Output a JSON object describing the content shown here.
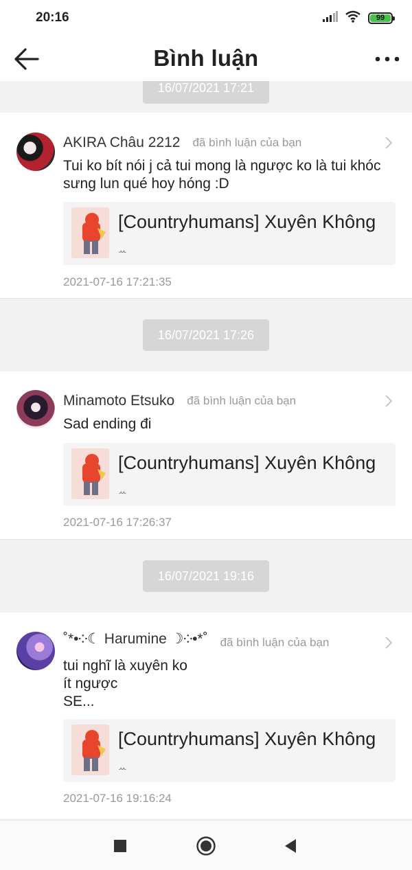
{
  "status_bar": {
    "time": "20:16",
    "battery": "99",
    "icons": [
      "signal-icon",
      "wifi-icon",
      "battery-icon"
    ]
  },
  "header": {
    "title": "Bình luận",
    "back_icon": "arrow-left-icon",
    "more_icon": "more-dots-icon"
  },
  "comments": [
    {
      "date_label": "16/07/2021 17:21",
      "author": "AKIRA Châu 2212",
      "action": "đã bình luận của bạn",
      "lines": [
        "Tui ko bít nói j cả tui mong là ngược ko là tui khóc",
        "sưng lun qué hoy hóng :D"
      ],
      "story_title": "[Countryhumans] Xuyên Không",
      "story_sub": "ꕀ",
      "timestamp": "2021-07-16 17:21:35"
    },
    {
      "date_label": "16/07/2021 17:26",
      "author": "Minamoto Etsuko",
      "action": "đã bình luận của bạn",
      "lines": [
        "Sad ending đi"
      ],
      "story_title": "[Countryhumans] Xuyên Không",
      "story_sub": "ꕀ",
      "timestamp": "2021-07-16 17:26:37"
    },
    {
      "date_label": "16/07/2021 19:16",
      "author": "˚*•༶☾ Harumine ☽༶•*˚",
      "action": "đã bình luận của bạn",
      "lines": [
        "tui nghĩ là xuyên ko",
        "ít ngược",
        "SE..."
      ],
      "story_title": "[Countryhumans] Xuyên Không",
      "story_sub": "ꕀ",
      "timestamp": "2021-07-16 19:16:24"
    }
  ],
  "nav_bar": {
    "icons": [
      "square-icon",
      "home-circle-icon",
      "back-triangle-icon"
    ]
  }
}
